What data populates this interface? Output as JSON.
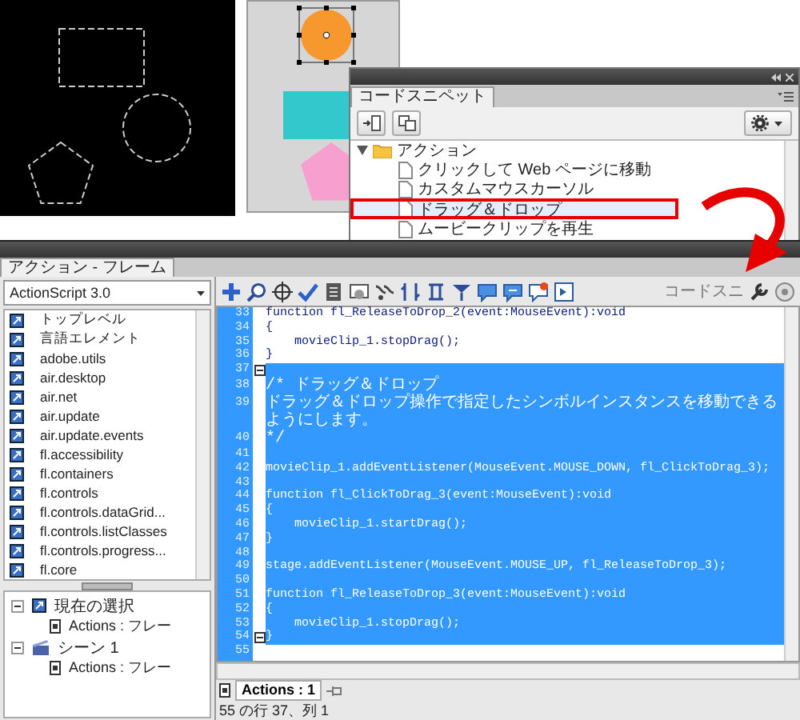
{
  "code_snippets_panel": {
    "tab": "コードスニペット",
    "folder": {
      "label": "アクション",
      "expanded": true,
      "children": [
        {
          "label": "クリックして Web ページに移動",
          "selected": false
        },
        {
          "label": "カスタムマウスカーソル",
          "selected": false
        },
        {
          "label": "ドラッグ＆ドロップ",
          "selected": true
        },
        {
          "label": "ムービークリップを再生",
          "selected": false
        }
      ]
    }
  },
  "actions_panel": {
    "tab": "アクション - フレーム",
    "language": "ActionScript 3.0",
    "toolbox_items": [
      "トップレベル",
      "言語エレメント",
      "adobe.utils",
      "air.desktop",
      "air.net",
      "air.update",
      "air.update.events",
      "fl.accessibility",
      "fl.containers",
      "fl.controls",
      "fl.controls.dataGrid...",
      "fl.controls.listClasses",
      "fl.controls.progress...",
      "fl.core"
    ],
    "script_tree": [
      {
        "label": "現在の選択",
        "kind": "selection",
        "expanded": true,
        "children": [
          {
            "label": "Actions : フレー"
          }
        ]
      },
      {
        "label": "シーン 1",
        "kind": "scene",
        "expanded": true,
        "children": [
          {
            "label": "Actions : フレー"
          }
        ]
      }
    ],
    "toolbar_label": "コードスニ",
    "code_lines": [
      {
        "number": "33",
        "text": "function fl_ReleaseToDrop_2(event:MouseEvent):void",
        "kind": "code",
        "selected": false,
        "fold": false
      },
      {
        "number": "34",
        "text": "{",
        "kind": "code",
        "selected": false,
        "fold": false
      },
      {
        "number": "35",
        "text": "    movieClip_1.stopDrag();",
        "kind": "code",
        "selected": false,
        "fold": false
      },
      {
        "number": "36",
        "text": "}",
        "kind": "code",
        "selected": false,
        "fold": false
      },
      {
        "number": "37",
        "kind": "code",
        "selected": true,
        "fold": true
      },
      {
        "number": "38",
        "text": "/* ドラッグ＆ドロップ",
        "kind": "comment",
        "selected": true,
        "fold": false
      },
      {
        "number": "39",
        "text": "ドラッグ＆ドロップ操作で指定したシンボルインスタンスを移動できるようにします。",
        "kind": "comment",
        "selected": true,
        "fold": false
      },
      {
        "number": "40",
        "text": "*/",
        "kind": "comment",
        "selected": true,
        "fold": false
      },
      {
        "number": "41",
        "kind": "code",
        "selected": true,
        "fold": false
      },
      {
        "number": "42",
        "text": "movieClip_1.addEventListener(MouseEvent.MOUSE_DOWN, fl_ClickToDrag_3);",
        "kind": "code",
        "selected": true,
        "fold": false
      },
      {
        "number": "43",
        "kind": "code",
        "selected": true,
        "fold": false
      },
      {
        "number": "44",
        "text": "function fl_ClickToDrag_3(event:MouseEvent):void",
        "kind": "code",
        "selected": true,
        "fold": false
      },
      {
        "number": "45",
        "text": "{",
        "kind": "code",
        "selected": true,
        "fold": false
      },
      {
        "number": "46",
        "text": "    movieClip_1.startDrag();",
        "kind": "code",
        "selected": true,
        "fold": false
      },
      {
        "number": "47",
        "text": "}",
        "kind": "code",
        "selected": true,
        "fold": false
      },
      {
        "number": "48",
        "kind": "code",
        "selected": true,
        "fold": false
      },
      {
        "number": "49",
        "text": "stage.addEventListener(MouseEvent.MOUSE_UP, fl_ReleaseToDrop_3);",
        "kind": "code",
        "selected": true,
        "fold": false
      },
      {
        "number": "50",
        "kind": "code",
        "selected": true,
        "fold": false
      },
      {
        "number": "51",
        "text": "function fl_ReleaseToDrop_3(event:MouseEvent):void",
        "kind": "code",
        "selected": true,
        "fold": false
      },
      {
        "number": "52",
        "text": "{",
        "kind": "code",
        "selected": true,
        "fold": false
      },
      {
        "number": "53",
        "text": "    movieClip_1.stopDrag();",
        "kind": "code",
        "selected": true,
        "fold": false
      },
      {
        "number": "54",
        "text": "}",
        "kind": "code",
        "selected": true,
        "fold": true
      },
      {
        "number": "55",
        "kind": "code",
        "selected": false,
        "fold": false
      }
    ],
    "script_tab": "Actions : 1",
    "status": "55 の行 37、列 1"
  }
}
